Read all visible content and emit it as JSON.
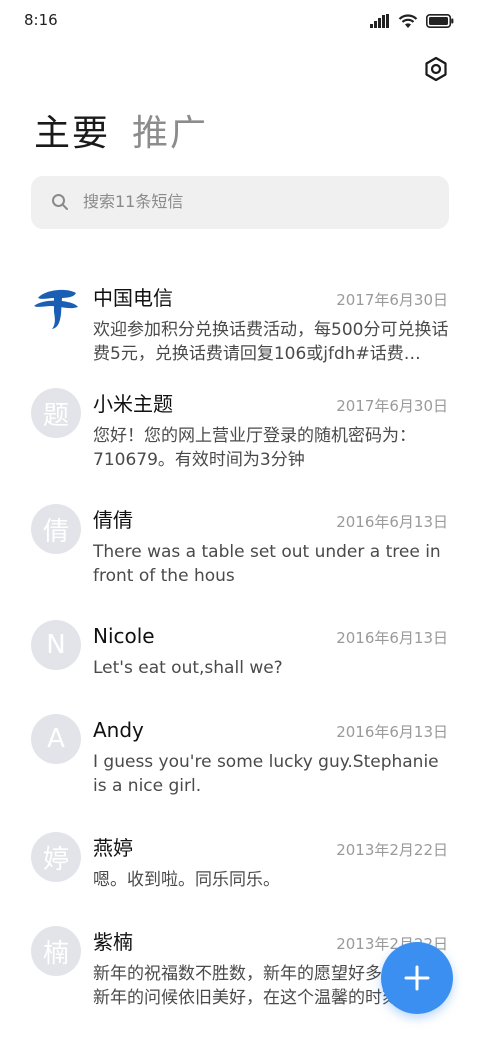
{
  "status_bar": {
    "time": "8:16",
    "icons": [
      "signal-icon",
      "wifi-icon",
      "battery-icon"
    ]
  },
  "header": {
    "settings_icon": "settings-icon",
    "tabs": [
      {
        "label": "主要",
        "active": true
      },
      {
        "label": "推广",
        "active": false
      }
    ]
  },
  "search": {
    "placeholder": "搜索11条短信",
    "icon": "search-icon"
  },
  "messages": [
    {
      "avatar": "",
      "avatar_type": "china-telecom-logo",
      "name": "中国电信",
      "date": "2017年6月30日",
      "preview": "欢迎参加积分兑换话费活动，每500分可兑换话费5元，兑换话费请回复106或jfdh#话费…"
    },
    {
      "avatar": "题",
      "name": "小米主题",
      "date": "2017年6月30日",
      "preview": "您好！您的网上营业厅登录的随机密码为：710679。有效时间为3分钟"
    },
    {
      "avatar": "倩",
      "name": "倩倩",
      "date": "2016年6月13日",
      "preview": "There was a table set out under a tree in front of the hous"
    },
    {
      "avatar": "N",
      "name": "Nicole",
      "date": "2016年6月13日",
      "preview": "Let's eat out,shall we?"
    },
    {
      "avatar": "A",
      "name": "Andy",
      "date": "2016年6月13日",
      "preview": "I guess you're some lucky guy.Stephanie is a nice girl."
    },
    {
      "avatar": "婷",
      "name": "燕婷",
      "date": "2013年2月22日",
      "preview": "嗯。收到啦。同乐同乐。"
    },
    {
      "avatar": "楠",
      "name": "紫楠",
      "date": "2013年2月22日",
      "preview": "新年的祝福数不胜数，新年的愿望好多好多，新年的问候依旧美好，在这个温馨的时刻"
    }
  ],
  "fab": {
    "icon": "plus-icon"
  },
  "colors": {
    "accent": "#3b8ff0",
    "avatar_bg": "#e2e4e9",
    "search_bg": "#f0f0f0",
    "telecom_blue": "#1a5fb4"
  }
}
